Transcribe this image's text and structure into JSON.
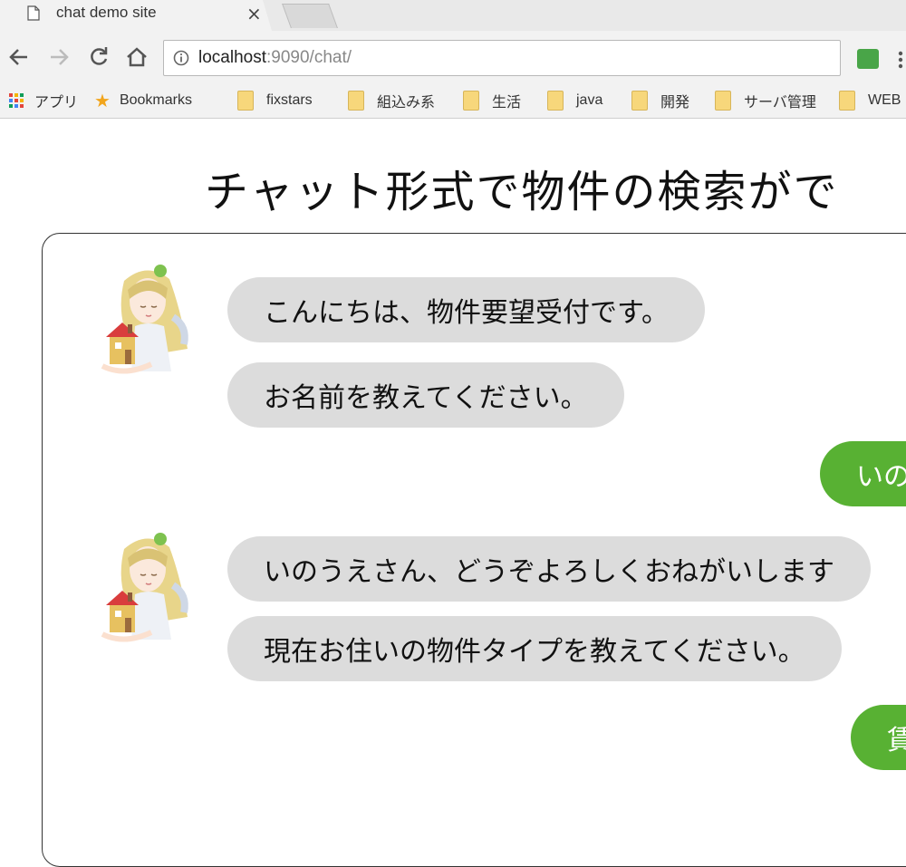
{
  "browser": {
    "tab_title": "chat demo site",
    "tab_close": "×",
    "url_host": "localhost",
    "url_rest": ":9090/chat/"
  },
  "bookmarks": [
    {
      "label": "アプリ",
      "kind": "apps"
    },
    {
      "label": "Bookmarks",
      "kind": "star"
    },
    {
      "label": "fixstars",
      "kind": "folder"
    },
    {
      "label": "組込み系",
      "kind": "folder"
    },
    {
      "label": "生活",
      "kind": "folder"
    },
    {
      "label": "java",
      "kind": "folder"
    },
    {
      "label": "開発",
      "kind": "folder"
    },
    {
      "label": "サーバ管理",
      "kind": "folder"
    },
    {
      "label": "WEB",
      "kind": "folder"
    }
  ],
  "page": {
    "title": "チャット形式で物件の検索がで"
  },
  "chat": {
    "messages": [
      {
        "from": "bot",
        "text": "こんにちは、物件要望受付です。"
      },
      {
        "from": "bot",
        "text": "お名前を教えてください。"
      },
      {
        "from": "user",
        "text": "いの"
      },
      {
        "from": "bot",
        "text": "いのうえさん、どうぞよろしくおねがいします"
      },
      {
        "from": "bot",
        "text": "現在お住いの物件タイプを教えてください。"
      },
      {
        "from": "user",
        "text": "賃"
      }
    ]
  },
  "colors": {
    "bot_bubble": "#dcdcdc",
    "user_bubble": "#58b133",
    "accent_green": "#49a548"
  }
}
